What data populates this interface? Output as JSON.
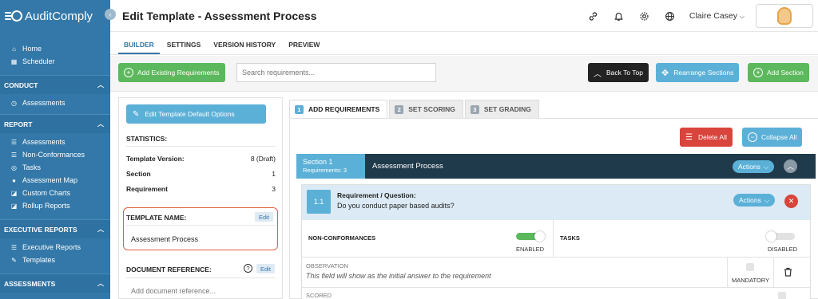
{
  "app": {
    "name": "AuditComply"
  },
  "sidebar": {
    "top_items": [
      {
        "label": "Home",
        "icon": "home-icon"
      },
      {
        "label": "Scheduler",
        "icon": "calendar-icon"
      }
    ],
    "sections": [
      {
        "title": "CONDUCT",
        "items": [
          {
            "label": "Assessments",
            "icon": "clock-icon"
          }
        ]
      },
      {
        "title": "REPORT",
        "items": [
          {
            "label": "Assessments",
            "icon": "list-icon"
          },
          {
            "label": "Non-Conformances",
            "icon": "list-icon"
          },
          {
            "label": "Tasks",
            "icon": "tasks-icon"
          },
          {
            "label": "Assessment Map",
            "icon": "map-pin-icon"
          },
          {
            "label": "Custom Charts",
            "icon": "chart-icon"
          },
          {
            "label": "Rollup Reports",
            "icon": "chart-icon"
          }
        ]
      },
      {
        "title": "EXECUTIVE REPORTS",
        "items": [
          {
            "label": "Executive Reports",
            "icon": "list-icon"
          },
          {
            "label": "Templates",
            "icon": "edit-icon"
          }
        ]
      },
      {
        "title": "ASSESSMENTS",
        "items": []
      }
    ]
  },
  "header": {
    "title": "Edit Template - Assessment Process",
    "user_name": "Claire Casey"
  },
  "tabs": [
    "BUILDER",
    "SETTINGS",
    "VERSION HISTORY",
    "PREVIEW"
  ],
  "toolbar": {
    "add_existing": "Add Existing Requirements",
    "search_placeholder": "Search requirements...",
    "back_to_top": "Back To Top",
    "rearrange": "Rearrange Sections",
    "add_section": "Add Section"
  },
  "left_panel": {
    "edit_defaults": "Edit Template Default Options",
    "statistics_label": "STATISTICS:",
    "stats": [
      {
        "key": "Template Version:",
        "value": "8 (Draft)"
      },
      {
        "key": "Section",
        "value": "1"
      },
      {
        "key": "Requirement",
        "value": "3"
      }
    ],
    "template_name_label": "TEMPLATE NAME:",
    "template_name": "Assessment Process",
    "edit_label": "Edit",
    "doc_ref_label": "DOCUMENT REFERENCE:",
    "doc_ref_placeholder": "Add document reference...",
    "help_mark": "?"
  },
  "right_panel": {
    "tabs": [
      {
        "num": "1",
        "label": "ADD REQUIREMENTS"
      },
      {
        "num": "2",
        "label": "SET SCORING"
      },
      {
        "num": "3",
        "label": "SET GRADING"
      }
    ],
    "delete_all": "Delete All",
    "collapse_all": "Collapse All",
    "section": {
      "number": "Section 1",
      "sub": "Requirements: 3",
      "title": "Assessment Process",
      "actions": "Actions"
    },
    "requirement": {
      "num": "1.1",
      "label": "Requirement / Question:",
      "question": "Do you conduct paper based audits?",
      "actions": "Actions",
      "non_conformances": "NON-CONFORMANCES",
      "enabled": "ENABLED",
      "tasks": "TASKS",
      "disabled": "DISABLED",
      "observation": "OBSERVATION",
      "observation_hint": "This field will show as the initial answer to the requirement",
      "mandatory": "MANDATORY",
      "scored": "SCORED"
    }
  },
  "colors": {
    "sidebar": "#3378a8",
    "accent": "#5bb0d7",
    "green": "#5cb85c",
    "danger": "#d9443c",
    "section_bar": "#1f3a4a"
  }
}
